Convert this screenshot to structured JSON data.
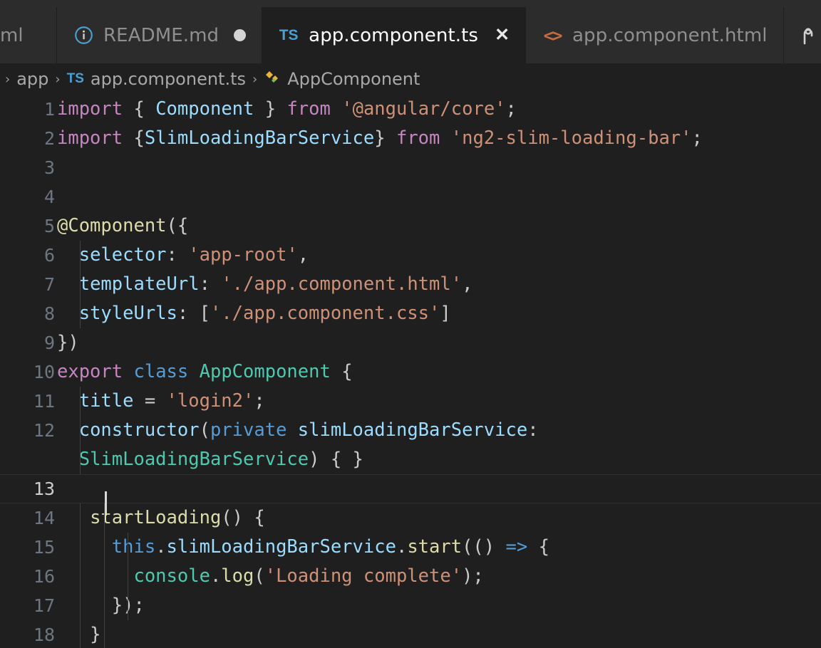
{
  "window": {
    "app": "Visual Studio Code",
    "theme_bg": "#1f1f1f",
    "tabbar_bg": "#2c2c2c"
  },
  "tabs": [
    {
      "label": "ml",
      "icon": "html-icon",
      "active": false,
      "modified": false,
      "clipped": true
    },
    {
      "label": "README.md",
      "icon": "info-icon",
      "active": false,
      "modified": true,
      "clipped": false
    },
    {
      "label": "app.component.ts",
      "icon": "ts-icon",
      "active": true,
      "modified": false,
      "close": "✕",
      "clipped": false
    },
    {
      "label": "app.component.html",
      "icon": "code-brackets-icon",
      "active": false,
      "modified": false,
      "clipped": false
    }
  ],
  "tabbar_action_icon": "split-editor-icon",
  "breadcrumb": {
    "separator": "›",
    "items": [
      {
        "label": "app",
        "icon": "chevron-right-icon"
      },
      {
        "label": "app.component.ts",
        "icon": "ts-icon"
      },
      {
        "label": "AppComponent",
        "icon": "class-symbol-icon"
      }
    ]
  },
  "editor": {
    "language": "TypeScript",
    "current_line": 13,
    "cursor": {
      "line": 13,
      "column": 3
    },
    "lines": [
      {
        "num": "1",
        "tokens": [
          {
            "t": "import",
            "c": "k"
          },
          {
            "t": " ",
            "c": "pun"
          },
          {
            "t": "{ ",
            "c": "pun"
          },
          {
            "t": "Component",
            "c": "var"
          },
          {
            "t": " }",
            "c": "pun"
          },
          {
            "t": " ",
            "c": "pun"
          },
          {
            "t": "from",
            "c": "k"
          },
          {
            "t": " ",
            "c": "pun"
          },
          {
            "t": "'@angular/core'",
            "c": "str"
          },
          {
            "t": ";",
            "c": "pun"
          }
        ]
      },
      {
        "num": "2",
        "tokens": [
          {
            "t": "import",
            "c": "k"
          },
          {
            "t": " ",
            "c": "pun"
          },
          {
            "t": "{",
            "c": "pun"
          },
          {
            "t": "SlimLoadingBarService",
            "c": "var"
          },
          {
            "t": "}",
            "c": "pun"
          },
          {
            "t": " ",
            "c": "pun"
          },
          {
            "t": "from",
            "c": "k"
          },
          {
            "t": " ",
            "c": "pun"
          },
          {
            "t": "'ng2-slim-loading-bar'",
            "c": "str"
          },
          {
            "t": ";",
            "c": "pun"
          }
        ]
      },
      {
        "num": "3",
        "tokens": []
      },
      {
        "num": "4",
        "tokens": []
      },
      {
        "num": "5",
        "tokens": [
          {
            "t": "@Component",
            "c": "dec"
          },
          {
            "t": "({",
            "c": "pun"
          }
        ]
      },
      {
        "num": "6",
        "tokens": [
          {
            "t": "  ",
            "c": "pun"
          },
          {
            "t": "selector",
            "c": "var"
          },
          {
            "t": ": ",
            "c": "pun"
          },
          {
            "t": "'app-root'",
            "c": "str"
          },
          {
            "t": ",",
            "c": "pun"
          }
        ],
        "guides": [
          1
        ]
      },
      {
        "num": "7",
        "tokens": [
          {
            "t": "  ",
            "c": "pun"
          },
          {
            "t": "templateUrl",
            "c": "var"
          },
          {
            "t": ": ",
            "c": "pun"
          },
          {
            "t": "'./app.component.html'",
            "c": "str"
          },
          {
            "t": ",",
            "c": "pun"
          }
        ],
        "guides": [
          1
        ]
      },
      {
        "num": "8",
        "tokens": [
          {
            "t": "  ",
            "c": "pun"
          },
          {
            "t": "styleUrls",
            "c": "var"
          },
          {
            "t": ": ",
            "c": "pun"
          },
          {
            "t": "[",
            "c": "pun"
          },
          {
            "t": "'./app.component.css'",
            "c": "str"
          },
          {
            "t": "]",
            "c": "pun"
          }
        ],
        "guides": [
          1
        ]
      },
      {
        "num": "9",
        "tokens": [
          {
            "t": "})",
            "c": "pun"
          }
        ]
      },
      {
        "num": "10",
        "tokens": [
          {
            "t": "export",
            "c": "k"
          },
          {
            "t": " ",
            "c": "pun"
          },
          {
            "t": "class",
            "c": "kw2"
          },
          {
            "t": " ",
            "c": "pun"
          },
          {
            "t": "AppComponent",
            "c": "typ"
          },
          {
            "t": " {",
            "c": "pun"
          }
        ]
      },
      {
        "num": "11",
        "tokens": [
          {
            "t": "  ",
            "c": "pun"
          },
          {
            "t": "title",
            "c": "var"
          },
          {
            "t": " = ",
            "c": "pun"
          },
          {
            "t": "'login2'",
            "c": "str"
          },
          {
            "t": ";",
            "c": "pun"
          }
        ],
        "guides": [
          1
        ]
      },
      {
        "num": "12",
        "tokens": [
          {
            "t": "  ",
            "c": "pun"
          },
          {
            "t": "constructor",
            "c": "var"
          },
          {
            "t": "(",
            "c": "pun"
          },
          {
            "t": "private",
            "c": "kw2"
          },
          {
            "t": " ",
            "c": "pun"
          },
          {
            "t": "slimLoadingBarService",
            "c": "var"
          },
          {
            "t": ":",
            "c": "pun"
          }
        ],
        "guides": [
          1
        ]
      },
      {
        "num": "",
        "wrapped": true,
        "tokens": [
          {
            "t": "  ",
            "c": "pun"
          },
          {
            "t": "SlimLoadingBarService",
            "c": "typ"
          },
          {
            "t": ") { }",
            "c": "pun"
          }
        ],
        "guides": [
          1
        ]
      },
      {
        "num": "13",
        "tokens": [],
        "current": true,
        "guides": [
          1,
          2
        ]
      },
      {
        "num": "14",
        "tokens": [
          {
            "t": "   ",
            "c": "pun"
          },
          {
            "t": "startLoading",
            "c": "fn"
          },
          {
            "t": "() {",
            "c": "pun"
          }
        ],
        "guides": [
          1,
          2
        ]
      },
      {
        "num": "15",
        "tokens": [
          {
            "t": "     ",
            "c": "pun"
          },
          {
            "t": "this",
            "c": "kw2"
          },
          {
            "t": ".",
            "c": "pun"
          },
          {
            "t": "slimLoadingBarService",
            "c": "var"
          },
          {
            "t": ".",
            "c": "pun"
          },
          {
            "t": "start",
            "c": "fn"
          },
          {
            "t": "(() ",
            "c": "pun"
          },
          {
            "t": "=>",
            "c": "op"
          },
          {
            "t": " {",
            "c": "pun"
          }
        ],
        "guides": [
          1,
          2,
          3
        ]
      },
      {
        "num": "16",
        "tokens": [
          {
            "t": "       ",
            "c": "pun"
          },
          {
            "t": "console",
            "c": "typ"
          },
          {
            "t": ".",
            "c": "pun"
          },
          {
            "t": "log",
            "c": "fn"
          },
          {
            "t": "(",
            "c": "pun"
          },
          {
            "t": "'Loading complete'",
            "c": "str"
          },
          {
            "t": ");",
            "c": "pun"
          }
        ],
        "guides": [
          1,
          2,
          3
        ]
      },
      {
        "num": "17",
        "tokens": [
          {
            "t": "     ",
            "c": "pun"
          },
          {
            "t": "});",
            "c": "pun"
          }
        ],
        "guides": [
          1,
          2,
          3
        ]
      },
      {
        "num": "18",
        "tokens": [
          {
            "t": "   ",
            "c": "pun"
          },
          {
            "t": "}",
            "c": "pun"
          }
        ],
        "guides": [
          1,
          2
        ]
      }
    ]
  }
}
